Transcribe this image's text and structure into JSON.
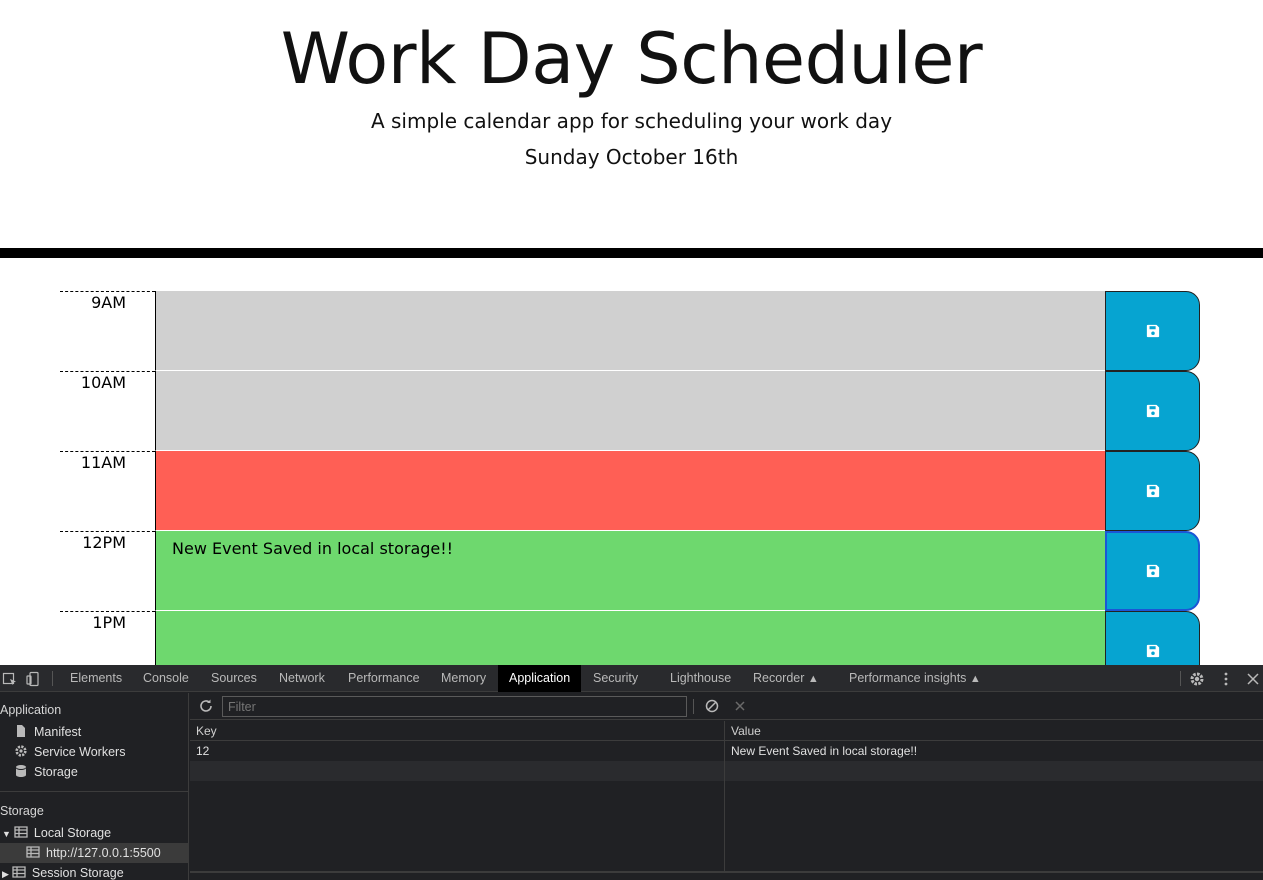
{
  "app": {
    "title": "Work Day Scheduler",
    "lead": "A simple calendar app for scheduling your work day",
    "current_date": "Sunday October 16th",
    "timeblocks": [
      {
        "hour": "9AM",
        "event": "",
        "status": "past"
      },
      {
        "hour": "10AM",
        "event": "",
        "status": "past"
      },
      {
        "hour": "11AM",
        "event": "",
        "status": "present"
      },
      {
        "hour": "12PM",
        "event": "New Event Saved in local storage!!",
        "status": "future"
      },
      {
        "hour": "1PM",
        "event": "",
        "status": "future"
      }
    ],
    "colors": {
      "past": "#d0d0d0",
      "present": "#ff5f55",
      "future": "#6ed86e",
      "save_button": "#06a4d1"
    },
    "save_icon": "floppy-disk-icon"
  },
  "devtools": {
    "tabs": [
      "Elements",
      "Console",
      "Sources",
      "Network",
      "Performance",
      "Memory",
      "Application",
      "Security",
      "Lighthouse",
      "Recorder",
      "Performance insights"
    ],
    "active_tab": "Application",
    "sidebar": {
      "application_heading": "Application",
      "application_items": [
        "Manifest",
        "Service Workers",
        "Storage"
      ],
      "storage_heading": "Storage",
      "local_storage": "Local Storage",
      "local_storage_origin": "http://127.0.0.1:5500",
      "session_storage": "Session Storage"
    },
    "filter_placeholder": "Filter",
    "table": {
      "columns": [
        "Key",
        "Value"
      ],
      "rows": [
        {
          "key": "12",
          "value": "New Event Saved in local storage!!"
        }
      ]
    }
  }
}
